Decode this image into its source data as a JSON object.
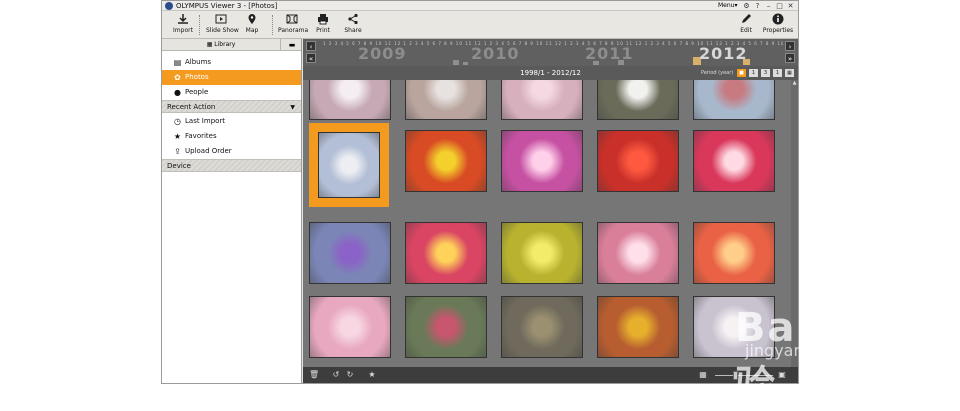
{
  "window": {
    "title": "OLYMPUS Viewer 3 - [Photos]",
    "menu": "Menu▾"
  },
  "toolbar": {
    "import": "Import",
    "slideshow": "Slide Show",
    "map": "Map",
    "panorama": "Panorama",
    "print": "Print",
    "share": "Share",
    "edit": "Edit",
    "properties": "Properties"
  },
  "sidebar": {
    "tab": "Library",
    "items": [
      {
        "label": "Albums"
      },
      {
        "label": "Photos"
      },
      {
        "label": "People"
      }
    ],
    "section_recent": "Recent Action",
    "recent": [
      {
        "label": "Last Import"
      },
      {
        "label": "Favorites"
      },
      {
        "label": "Upload Order"
      }
    ],
    "section_device": "Device"
  },
  "timeline": {
    "years": [
      "2009",
      "2010",
      "2011",
      "2012"
    ],
    "ticks": "1 2 3 4 5 6 7 8 9 10 11 12 1 2 3 4 5 6 7 8 9 10 11 12 1 2 3 4 5 6 7 8 9 10 11 12 1 2 3 4 5 6 7 8 9 10 11 12 1 2 3 4 5 6 7 8 9 10 11 12 1 2 3 4 5 6 7 8 9 10 11 12 1 2 3 4 5 6 7 8 9 10 11 12",
    "range": "1998/1 - 2012/12",
    "period_label": "Period (year)",
    "period_buttons": [
      "■",
      "1",
      "3",
      "1",
      "▦"
    ]
  },
  "photos": {
    "colors": [
      "#c7a9b5",
      "#b9a59e",
      "#d7b0bd",
      "#6b6b5a",
      "#a8b8cc",
      "#b3bfd6",
      "#d84b24",
      "#c651a2",
      "#c9302a",
      "#d9385b",
      "#7b86b6",
      "#d94563",
      "#b8b22f",
      "#d97f9a",
      "#ea6245",
      "#e8a8c0",
      "#6a7a58",
      "#6f6a5c",
      "#b75d30",
      "#c9c3d0"
    ],
    "accents": [
      "#f4eef2",
      "#e7e2e0",
      "#f4d9e2",
      "#f1f1ee",
      "#c77a80",
      "#eceef2",
      "#f4d02c",
      "#ffd0ea",
      "#ff5a40",
      "#ffd9e3",
      "#8b62c7",
      "#ffd25a",
      "#f1ec6a",
      "#ffe0ea",
      "#ffce8a",
      "#f8d7e3",
      "#c7566e",
      "#9b9070",
      "#e6b02c",
      "#f6f2f4"
    ]
  },
  "watermark": {
    "text": "Baidu经验",
    "url": "jingyan.baidu.com"
  }
}
